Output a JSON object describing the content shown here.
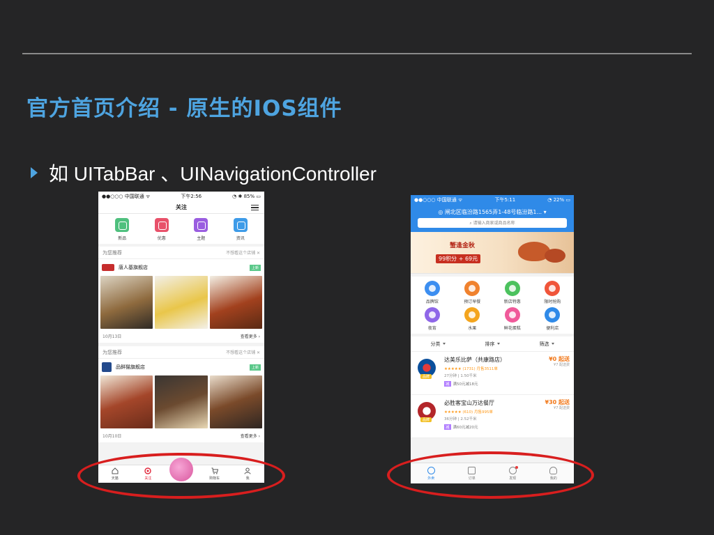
{
  "slide": {
    "title": "官方首页介绍 - 原生的IOS组件",
    "bullet": "如 UITabBar 、UINavigationController"
  },
  "phone_left": {
    "status": {
      "carrier": "●●○○○ 中国联通 ᯤ",
      "time": "下午2:56",
      "battery": "◔ ✱ 85% ▭"
    },
    "nav_title": "关注",
    "categories": [
      "新品",
      "优惠",
      "主题",
      "资讯"
    ],
    "card1": {
      "header": "为您推荐",
      "dismiss": "不想看这个店铺 ✕",
      "shop": "唐人基旗舰店",
      "tag": "上新",
      "date": "10月13日",
      "more": "查看更多 ›"
    },
    "card2": {
      "header": "为您推荐",
      "dismiss": "不想看这个店铺 ✕",
      "shop": "品鲜猫旗舰店",
      "tag": "上新",
      "date": "10月10日",
      "more": "查看更多 ›"
    },
    "tabs": [
      "天猫",
      "关注",
      "",
      "购物车",
      "我"
    ]
  },
  "phone_right": {
    "status": {
      "carrier": "●●○○○ 中国联通 ᯤ",
      "time": "下午5:11",
      "battery": "◔ 22% ▭"
    },
    "location": "◎ 闸北区临汾路1565弄1-48号临汾路1... ▾",
    "search_placeholder": "⌕ 请输入商家或商品名称",
    "banner": {
      "title": "蟹逢金秋",
      "price": "99积分 + 69元"
    },
    "grid": [
      "品牌馆",
      "预订早餐",
      "新店特惠",
      "限时抢购",
      "夜宵",
      "水果",
      "鲜花蛋糕",
      "便利店"
    ],
    "filters": [
      "分类",
      "排序",
      "筛选"
    ],
    "stores": [
      {
        "name": "达美乐比萨（共康路店）",
        "badge": "品牌",
        "rating": "★★★★★ (1731) 月售3511单",
        "eta": "27分钟 | 1.50千米",
        "promo": "满50元减18元",
        "fee_main": "¥0 起送",
        "fee_sub": "¥7 配送费"
      },
      {
        "name": "必胜客宝山万达餐厅",
        "badge": "品牌",
        "rating": "★★★★★ (610) 月售995单",
        "eta": "36分钟 | 2.52千米",
        "promo": "满60元减20元",
        "fee_main": "¥30 起送",
        "fee_sub": "¥7 配送费"
      }
    ],
    "tabs": [
      "外卖",
      "订单",
      "发现",
      "我的"
    ]
  },
  "colors": {
    "background": "#252526",
    "title_blue": "#4ea4e0",
    "circle_red": "#d81e1e",
    "ele_blue": "#2f8ae8",
    "tmall_red": "#e0263a"
  }
}
